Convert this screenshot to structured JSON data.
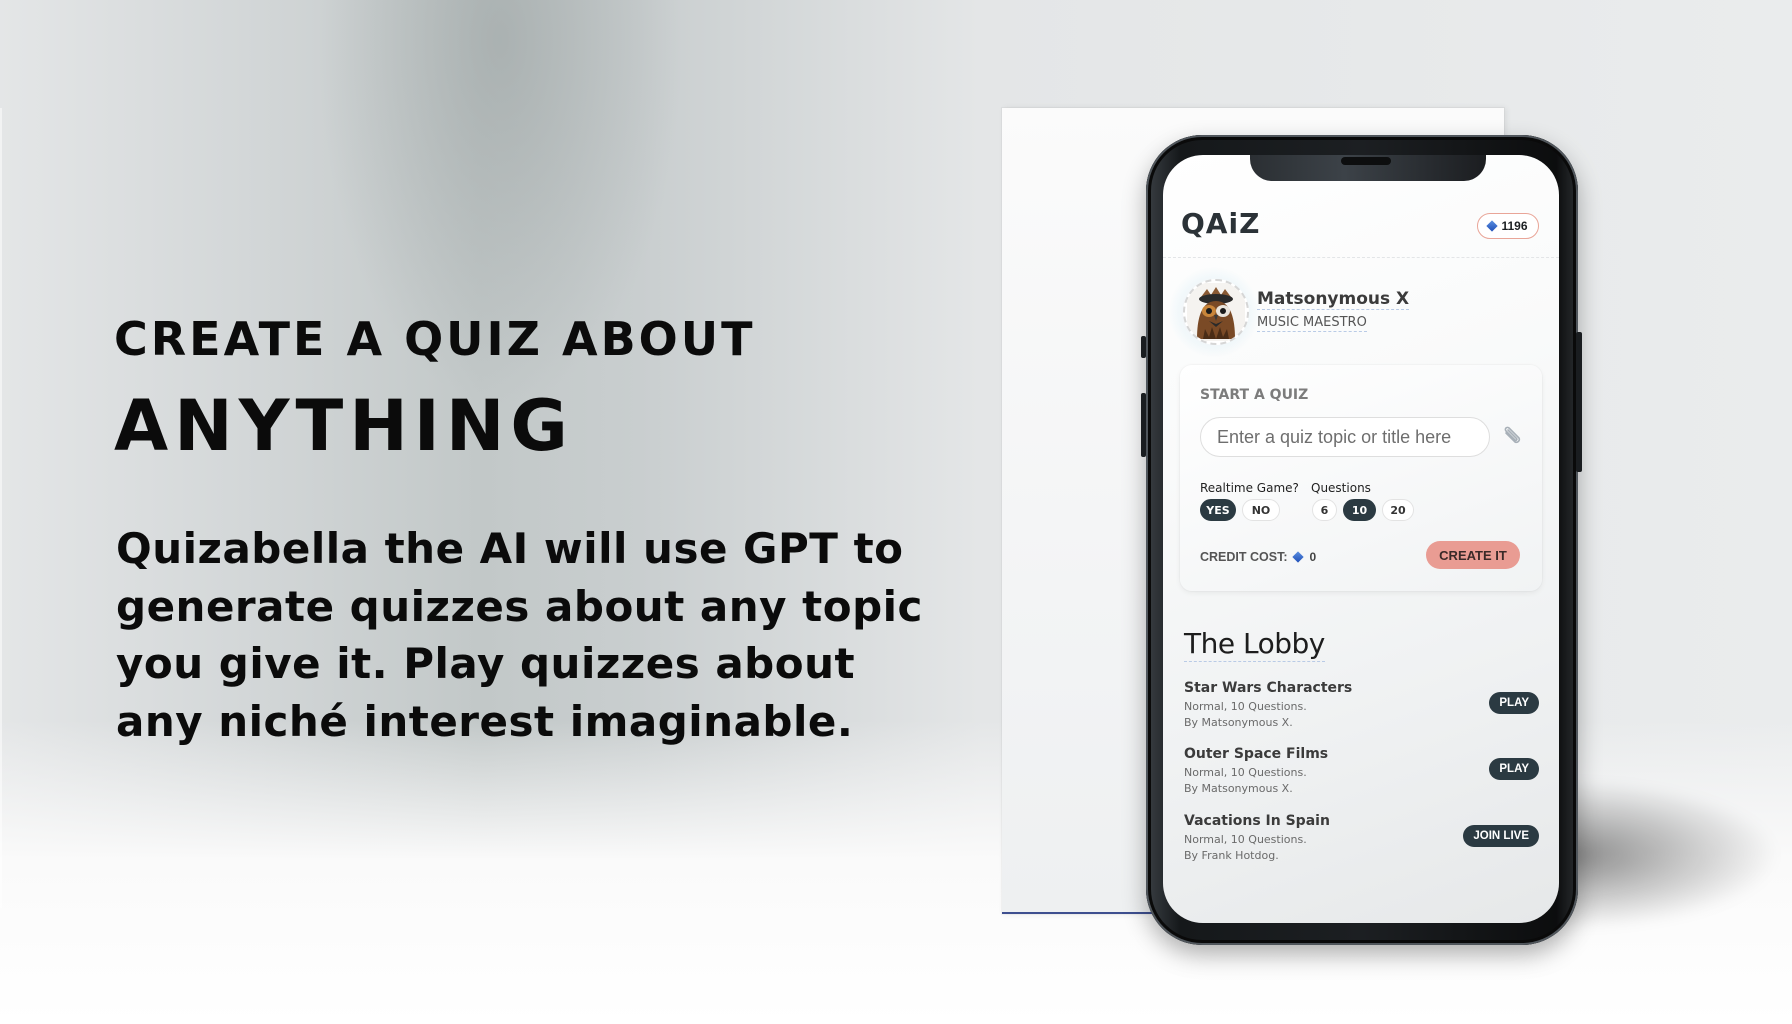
{
  "marketing": {
    "headline_line1": "CREATE A QUIZ ABOUT",
    "headline_line2": "ANYTHING",
    "description": "Quizabella the AI will use GPT to generate quizzes about any topic you give it. Play quizzes about any niché interest imaginable."
  },
  "app": {
    "logo": "QAiZ",
    "credits": "1196",
    "credit_icon": "diamond-icon",
    "accent_color": "#e99c93",
    "dark_color": "#2b3a42"
  },
  "profile": {
    "name": "Matsonymous X",
    "title": "MUSIC MAESTRO",
    "avatar": "owl-avatar"
  },
  "start_quiz": {
    "title": "START A QUIZ",
    "input_placeholder": "Enter a quiz topic or title here",
    "input_value": "",
    "attach_icon": "paperclip-icon",
    "realtime_label": "Realtime Game?",
    "realtime_options": [
      {
        "label": "YES",
        "selected": true
      },
      {
        "label": "NO",
        "selected": false
      }
    ],
    "questions_label": "Questions",
    "questions_options": [
      {
        "label": "6",
        "selected": false
      },
      {
        "label": "10",
        "selected": true
      },
      {
        "label": "20",
        "selected": false
      }
    ],
    "credit_cost_label": "CREDIT COST:",
    "credit_cost_value": "0",
    "create_button": "CREATE IT"
  },
  "lobby": {
    "title": "The Lobby",
    "items": [
      {
        "name": "Star Wars Characters",
        "details": "Normal, 10 Questions.",
        "author": "By Matsonymous X.",
        "action": "PLAY"
      },
      {
        "name": "Outer Space Films",
        "details": "Normal, 10 Questions.",
        "author": "By Matsonymous X.",
        "action": "PLAY"
      },
      {
        "name": "Vacations In Spain",
        "details": "Normal, 10 Questions.",
        "author": "By Frank Hotdog.",
        "action": "JOIN LIVE"
      }
    ]
  }
}
